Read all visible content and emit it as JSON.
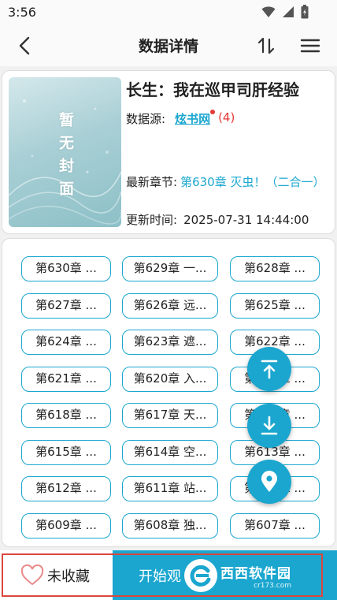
{
  "status": {
    "time": "3:56"
  },
  "toolbar": {
    "title": "数据详情"
  },
  "book": {
    "cover_text": "暂无封面",
    "title": "长生：我在巡甲司肝经验",
    "source_label": "数据源:",
    "source_name": "炫书网",
    "source_count": "(4)",
    "latest_label": "最新章节:",
    "latest_chapter": "第630章 灭虫！（二合一）",
    "update_label": "更新时间:",
    "update_time": "2025-07-31 14:44:00"
  },
  "chapters": [
    [
      "第630章 ...",
      "第629章 一...",
      "第628章 ..."
    ],
    [
      "第627章 ...",
      "第626章 远...",
      "第625章 ..."
    ],
    [
      "第624章 ...",
      "第623章 遮...",
      "第622章 ..."
    ],
    [
      "第621章 ...",
      "第620章 入...",
      "第619章 ..."
    ],
    [
      "第618章 ...",
      "第617章 天...",
      "第616章 ..."
    ],
    [
      "第615章 ...",
      "第614章 空...",
      "第613章 ..."
    ],
    [
      "第612章 ...",
      "第611章 站...",
      "第610章 ..."
    ],
    [
      "第609章 ...",
      "第608章 独...",
      "第607章 ..."
    ]
  ],
  "bottom": {
    "favorite_label": "未收藏",
    "start_label": "开始观",
    "watermark_main": "西西软件园",
    "watermark_sub": "cr173.com"
  },
  "icons": {
    "back": "back-arrow-icon",
    "sort": "sort-icon",
    "menu": "menu-icon",
    "fab_top": "scroll-top-icon",
    "fab_bottom": "scroll-bottom-icon",
    "fab_locate": "location-icon",
    "favorite": "heart-outline-icon"
  },
  "colors": {
    "accent": "#1aa6cf",
    "badge": "#e53935",
    "highlight": "#d9473c"
  }
}
